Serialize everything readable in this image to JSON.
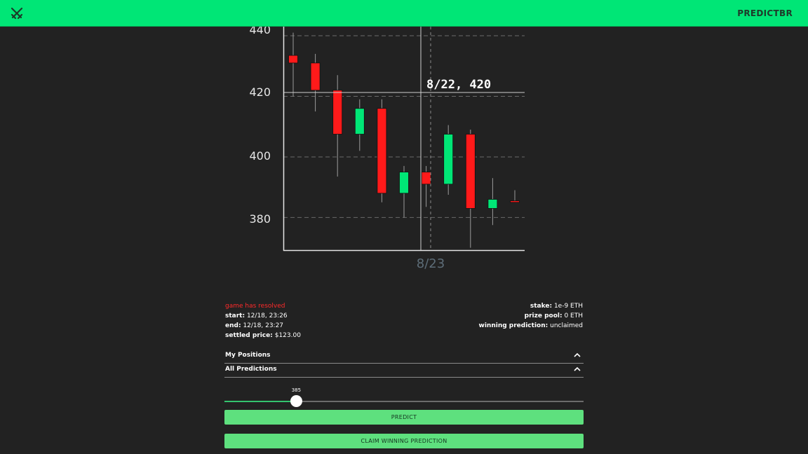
{
  "appbar": {
    "title": "PREDICTBR",
    "icon": "crossed-swords-icon",
    "color": "#00e676"
  },
  "chart_data": {
    "type": "candlestick",
    "y_ticks": [
      "440",
      "420",
      "400",
      "380"
    ],
    "ylim": [
      369,
      443
    ],
    "grid": "dashed horizontal",
    "up_color": "#00e676",
    "down_color": "#ff1a1a",
    "candles": [
      {
        "open": 433.5,
        "high": 441,
        "low": 420,
        "close": 431
      },
      {
        "open": 431,
        "high": 434,
        "low": 415,
        "close": 422
      },
      {
        "open": 422,
        "high": 427,
        "low": 393.5,
        "close": 407.5
      },
      {
        "open": 407.5,
        "high": 419,
        "low": 402,
        "close": 416
      },
      {
        "open": 416,
        "high": 419,
        "low": 385,
        "close": 388
      },
      {
        "open": 388,
        "high": 397,
        "low": 380,
        "close": 395
      },
      {
        "open": 395,
        "high": 397,
        "low": 383.5,
        "close": 391
      },
      {
        "open": 391,
        "high": 410.5,
        "low": 387.5,
        "close": 407.5
      },
      {
        "open": 407.5,
        "high": 409,
        "low": 370,
        "close": 383
      },
      {
        "open": 383,
        "high": 393,
        "low": 377.5,
        "close": 386
      },
      {
        "open": 385.5,
        "high": 389,
        "low": 385,
        "close": 385
      }
    ],
    "crosshair": {
      "label": "8/22, 420",
      "x_label": "8/23"
    }
  },
  "game": {
    "status": "game has resolved",
    "start_label": "start:",
    "start_value": "12/18, 23:26",
    "end_label": "end:",
    "end_value": "12/18, 23:27",
    "settled_label": "settled price:",
    "settled_value": "$123.00",
    "stake_label": "stake:",
    "stake_value": "1e-9 ETH",
    "pool_label": "prize pool:",
    "pool_value": "0 ETH",
    "winner_label": "winning prediction:",
    "winner_value": "unclaimed"
  },
  "sections": {
    "positions": "My Positions",
    "predictions": "All Predictions",
    "chevron_icon": "chevron-up-icon"
  },
  "slider": {
    "value": "385",
    "fraction": 0.2
  },
  "buttons": {
    "predict": "PREDICT",
    "claim": "CLAIM WINNING PREDICTION"
  }
}
